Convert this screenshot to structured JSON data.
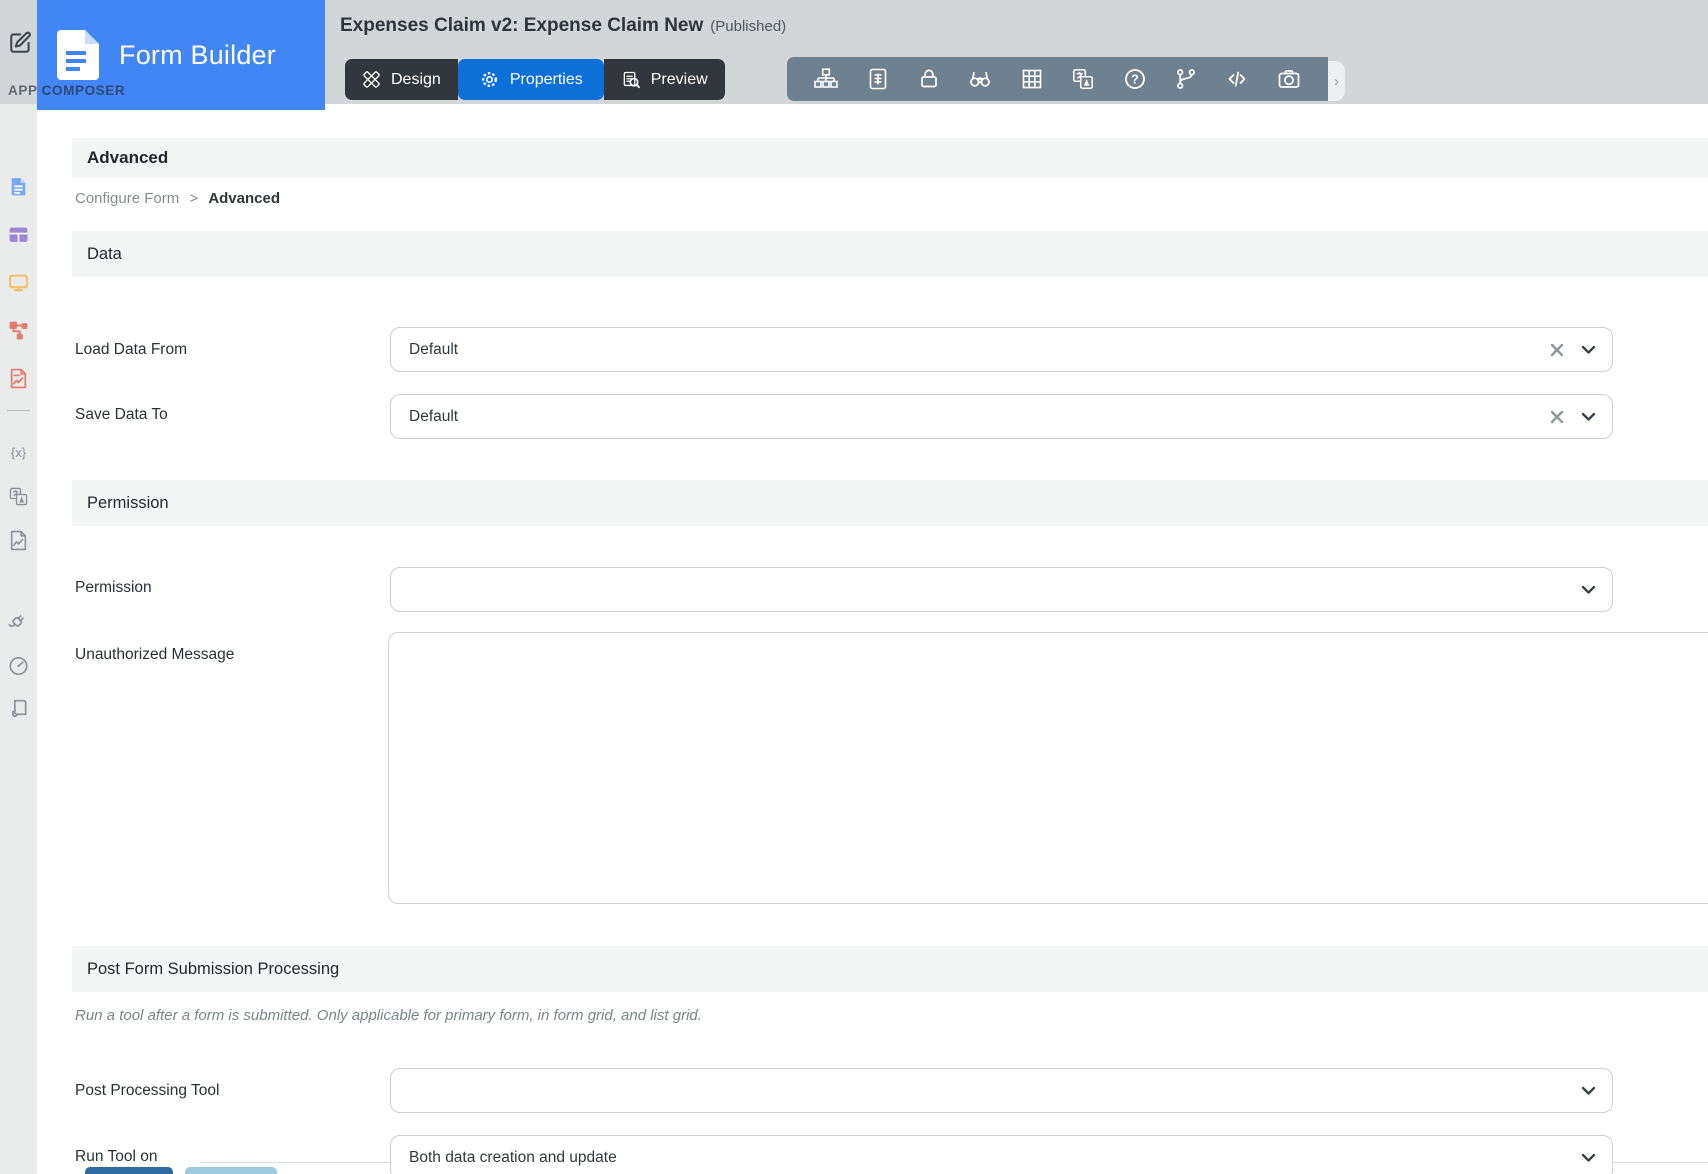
{
  "app": {
    "composer_label": "APP COMPOSER",
    "builder_name": "Form Builder",
    "document_title": "Expenses Claim v2: Expense Claim New",
    "status": "(Published)"
  },
  "header": {
    "mode_tabs": [
      {
        "label": "Design"
      },
      {
        "label": "Properties"
      },
      {
        "label": "Preview"
      }
    ],
    "active_tab": "Properties",
    "toolbar_icon_names": [
      "sitemap-icon",
      "form-details-icon",
      "lock-icon",
      "binoculars-icon",
      "grid-icon",
      "translate-icon",
      "help-icon",
      "branch-icon",
      "code-icon",
      "camera-icon"
    ],
    "more_chevron": "›"
  },
  "sidebar": {
    "icon_names": [
      "form-builder-icon",
      "datalist-builder-icon",
      "userview-builder-icon",
      "process-builder-icon",
      "report-builder-icon",
      "variable-icon",
      "translate-icon",
      "resources-icon",
      "plugin-icon",
      "performance-icon",
      "notes-icon"
    ],
    "variable_icon_text": "{x}"
  },
  "content": {
    "page_title": "Advanced",
    "breadcrumb": {
      "root": "Configure Form",
      "separator": ">",
      "current": "Advanced"
    },
    "data_section": {
      "title": "Data",
      "load_data_from": {
        "label": "Load Data From",
        "value": "Default"
      },
      "save_data_to": {
        "label": "Save Data To",
        "value": "Default"
      }
    },
    "permission_section": {
      "title": "Permission",
      "permission": {
        "label": "Permission",
        "value": ""
      },
      "unauthorized_message": {
        "label": "Unauthorized Message",
        "value": ""
      }
    },
    "post_section": {
      "title": "Post Form Submission Processing",
      "note": "Run a tool after a form is submitted. Only applicable for primary form, in form grid, and list grid.",
      "post_processing_tool": {
        "label": "Post Processing Tool",
        "value": ""
      },
      "run_tool_on": {
        "label": "Run Tool on",
        "value": "Both data creation and update"
      }
    }
  },
  "colors": {
    "brand_blue": "#4285f4",
    "active_tab_blue": "#0d6fd8",
    "tab_dark": "#32373d",
    "toolbar_slate": "#6e8191",
    "header_gray": "#d3d6d9"
  }
}
